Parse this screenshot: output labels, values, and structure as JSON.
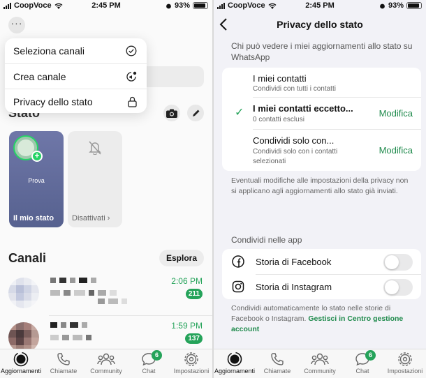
{
  "status_bar": {
    "carrier": "CoopVoce",
    "time": "2:45 PM",
    "battery": "93%"
  },
  "left": {
    "menu": [
      {
        "label": "Seleziona canali",
        "icon": "check-circle-icon"
      },
      {
        "label": "Crea canale",
        "icon": "new-channel-icon"
      },
      {
        "label": "Privacy dello stato",
        "icon": "lock-icon"
      }
    ],
    "stato_title": "Stato",
    "my_status": {
      "label": "Il mio stato",
      "preview_text": "Prova"
    },
    "muted": {
      "label": "Disattivati"
    },
    "channels_title": "Canali",
    "explore_label": "Esplora",
    "channels": [
      {
        "time": "2:06 PM",
        "unread": "211"
      },
      {
        "time": "1:59 PM",
        "unread": "137"
      }
    ]
  },
  "tabbar": {
    "tabs": [
      {
        "label": "Aggiornamenti",
        "icon": "updates-icon",
        "active": true
      },
      {
        "label": "Chiamate",
        "icon": "phone-icon"
      },
      {
        "label": "Community",
        "icon": "community-icon"
      },
      {
        "label": "Chat",
        "icon": "chat-icon",
        "badge": "6"
      },
      {
        "label": "Impostazioni",
        "icon": "settings-icon"
      }
    ]
  },
  "right": {
    "title": "Privacy dello stato",
    "who_header": "Chi può vedere i miei aggiornamenti allo stato su WhatsApp",
    "options": [
      {
        "title": "I miei contatti",
        "subtitle": "Condividi con tutti i contatti",
        "selected": false
      },
      {
        "title": "I miei contatti eccetto...",
        "subtitle": "0 contatti esclusi",
        "selected": true,
        "action": "Modifica"
      },
      {
        "title": "Condividi solo con...",
        "subtitle": "Condividi solo con i contatti selezionati",
        "selected": false,
        "action": "Modifica"
      }
    ],
    "privacy_note": "Eventuali modifiche alle impostazioni della privacy non si applicano agli aggiornamenti allo stato già inviati.",
    "share_header": "Condividi nelle app",
    "apps": [
      {
        "label": "Storia di Facebook",
        "icon": "facebook-icon",
        "enabled": false
      },
      {
        "label": "Storia di Instagram",
        "icon": "instagram-icon",
        "enabled": false
      }
    ],
    "share_note": "Condividi automaticamente lo stato nelle storie di Facebook o Instagram.",
    "share_note_link": "Gestisci in Centro gestione account"
  },
  "colors": {
    "accent": "#25a35a",
    "accent_text": "#1f8a4c",
    "status_ring": "#25d366"
  }
}
